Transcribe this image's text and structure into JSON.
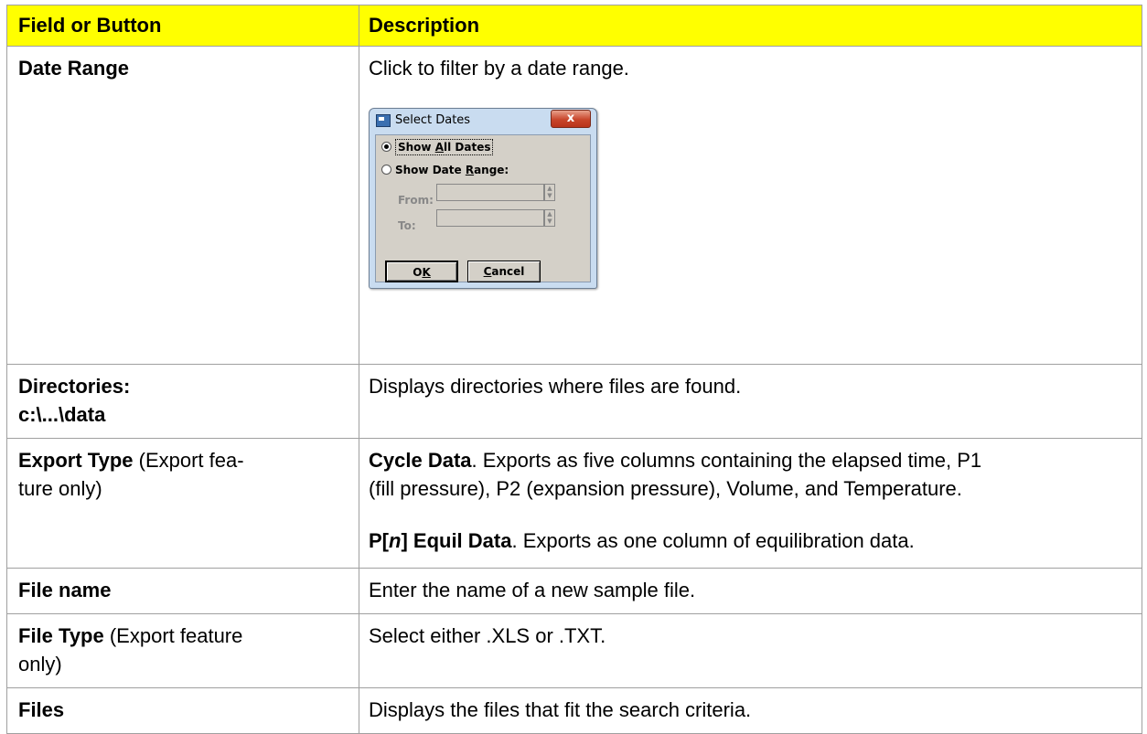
{
  "header": {
    "col1": "Field or Button",
    "col2": "Description"
  },
  "rows": {
    "date_range": {
      "field": "Date Range",
      "desc": "Click to filter by a date range."
    },
    "directories": {
      "field_line1": "Directories:",
      "field_line2": "c:\\...\\data",
      "desc": "Displays directories where files are found."
    },
    "export_type": {
      "field_bold": "Export Type",
      "field_normal": " (Export fea-",
      "field_normal2": "ture only)",
      "cycle_bold": "Cycle Data",
      "cycle_text_line1": ". Exports as five columns containing the elapsed time, P1",
      "cycle_text_line2": "(fill pressure), P2 (expansion pressure), Volume, and Temperature.",
      "equil_bold_a": "P[",
      "equil_italic": "n",
      "equil_bold_b": "] Equil Data",
      "equil_text": ". Exports as one column of equilibration data."
    },
    "file_name": {
      "field": "File name",
      "desc": "Enter the name of a new sample file."
    },
    "file_type": {
      "field_bold": "File Type",
      "field_normal": " (Export feature",
      "field_normal2": "only)",
      "desc": "Select either .XLS or .TXT."
    },
    "files": {
      "field": "Files",
      "desc": "Displays the files that fit the search criteria."
    }
  },
  "dialog": {
    "title": "Select Dates",
    "close_glyph": "x",
    "show_all_pre": "Show ",
    "show_all_u": "A",
    "show_all_post": "ll Dates",
    "show_range_pre": "Show Date ",
    "show_range_u": "R",
    "show_range_post": "ange:",
    "from_label": "From:",
    "to_label": "To:",
    "ok_pre": "O",
    "ok_u": "K",
    "cancel_u": "C",
    "cancel_post": "ancel",
    "selected_option": "Show All Dates"
  }
}
